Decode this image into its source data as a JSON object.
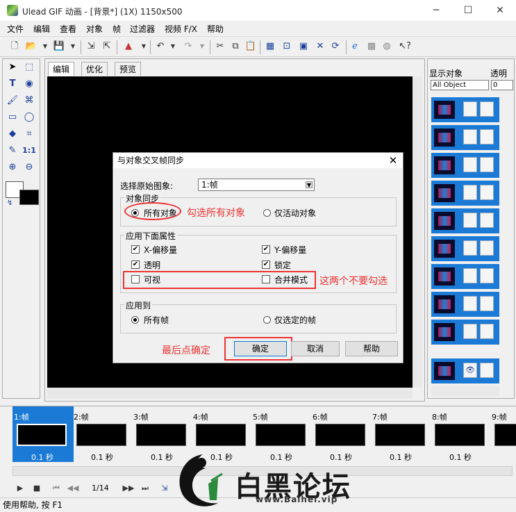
{
  "window": {
    "title": "Ulead GIF 动画 - [背景*] (1X) 1150x500",
    "minimize": "─",
    "maximize": "☐",
    "close": "✕"
  },
  "menu": [
    "文件",
    "编辑",
    "查看",
    "对象",
    "帧",
    "过滤器",
    "视频 F/X",
    "帮助"
  ],
  "tabs": [
    "编辑",
    "优化",
    "预览"
  ],
  "object_panel": {
    "header": "显示对象",
    "header2": "透明",
    "filter_value": "All Object",
    "opacity_value": "0"
  },
  "dialog": {
    "title": "与对象交叉帧同步",
    "close": "✕",
    "source_label": "选择原始图象:",
    "source_value": "1:帧",
    "group_sync": "对象同步",
    "sync_all": "所有对象",
    "sync_active": "仅活动对象",
    "group_apply": "应用下面属性",
    "x_offset": "X-偏移量",
    "y_offset": "Y-偏移量",
    "transparent": "透明",
    "lock": "锁定",
    "visible": "可视",
    "merge_mode": "合并模式",
    "group_to": "应用到",
    "all_frames": "所有帧",
    "selected_frames": "仅选定的帧",
    "ok": "确定",
    "cancel": "取消",
    "help": "帮助"
  },
  "annotations": {
    "select_all": "勾选所有对象",
    "dont_check": "这两个不要勾选",
    "confirm": "最后点确定"
  },
  "frames": [
    {
      "label": "1:帧",
      "delay": "0.1 秒"
    },
    {
      "label": "2:帧",
      "delay": "0.1 秒"
    },
    {
      "label": "3:帧",
      "delay": "0.1 秒"
    },
    {
      "label": "4:帧",
      "delay": "0.1 秒"
    },
    {
      "label": "5:帧",
      "delay": "0.1 秒"
    },
    {
      "label": "6:帧",
      "delay": "0.1 秒"
    },
    {
      "label": "7:帧",
      "delay": "0.1 秒"
    },
    {
      "label": "8:帧",
      "delay": "0.1 秒"
    },
    {
      "label": "9:帧",
      "delay": ""
    }
  ],
  "playbar": {
    "counter": "1/14"
  },
  "status": "使用帮助, 按 F1",
  "watermark": {
    "name": "白黑论坛",
    "url": "www.Baihei.vip"
  },
  "colors": {
    "accent": "#1b7ad6",
    "annotation": "#e33333"
  }
}
